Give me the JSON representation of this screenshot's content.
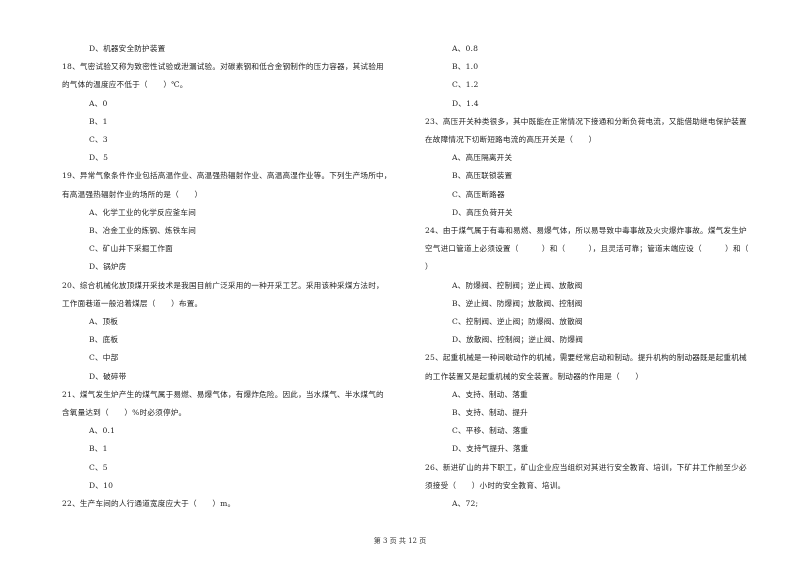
{
  "left_column": [
    {
      "type": "option",
      "text": "D、机器安全防护装置"
    },
    {
      "type": "question",
      "text": "18、气密试验又称为致密性试验或泄漏试验。对碳素钢和低合金钢制作的压力容器，其试验用"
    },
    {
      "type": "question",
      "text": "的气体的温度应不低于（　　）℃。"
    },
    {
      "type": "option",
      "text": "A、0"
    },
    {
      "type": "option",
      "text": "B、1"
    },
    {
      "type": "option",
      "text": "C、3"
    },
    {
      "type": "option",
      "text": "D、5"
    },
    {
      "type": "question",
      "text": "19、异常气象条件作业包括高温作业、高温强热辐射作业、高温高湿作业等。下列生产场所中，"
    },
    {
      "type": "question",
      "text": "有高温强热辐射作业的场所的是（　　）"
    },
    {
      "type": "option",
      "text": "A、化学工业的化学反应釜车间"
    },
    {
      "type": "option",
      "text": "B、冶金工业的炼钢、炼铁车间"
    },
    {
      "type": "option",
      "text": "C、矿山井下采掘工作面"
    },
    {
      "type": "option",
      "text": "D、锅炉房"
    },
    {
      "type": "question",
      "text": "20、综合机械化放顶煤开采技术是我国目前广泛采用的一种开采工艺。采用该种采煤方法时，"
    },
    {
      "type": "question",
      "text": "工作面巷道一般沿着煤层（　　）布置。"
    },
    {
      "type": "option",
      "text": "A、顶板"
    },
    {
      "type": "option",
      "text": "B、底板"
    },
    {
      "type": "option",
      "text": "C、中部"
    },
    {
      "type": "option",
      "text": "D、破碎带"
    },
    {
      "type": "question",
      "text": "21、煤气发生炉产生的煤气属于易燃、易爆气体，有爆炸危险。因此，当水煤气、半水煤气的"
    },
    {
      "type": "question",
      "text": "含氧量达到（　　）%时必须停炉。"
    },
    {
      "type": "option",
      "text": "A、0.1"
    },
    {
      "type": "option",
      "text": "B、1"
    },
    {
      "type": "option",
      "text": "C、5"
    },
    {
      "type": "option",
      "text": "D、10"
    },
    {
      "type": "question",
      "text": "22、生产车间的人行通道宽度应大于（　　）m。"
    }
  ],
  "right_column": [
    {
      "type": "option",
      "text": "A、0.8"
    },
    {
      "type": "option",
      "text": "B、1.0"
    },
    {
      "type": "option",
      "text": "C、1.2"
    },
    {
      "type": "option",
      "text": "D、1.4"
    },
    {
      "type": "question",
      "text": "23、高压开关种类很多，其中既能在正常情况下接通和分断负荷电流，又能借助继电保护装置"
    },
    {
      "type": "question",
      "text": "在故障情况下切断短路电流的高压开关是（　　）"
    },
    {
      "type": "option",
      "text": "A、高压隔离开关"
    },
    {
      "type": "option",
      "text": "B、高压联锁装置"
    },
    {
      "type": "option",
      "text": "C、高压断路器"
    },
    {
      "type": "option",
      "text": "D、高压负荷开关"
    },
    {
      "type": "question",
      "text": "24、由于煤气属于有毒和易燃、易爆气体，所以易导致中毒事故及火灾爆炸事故。煤气发生炉"
    },
    {
      "type": "question",
      "text": "空气进口管道上必须设置（　　　）和（　　　），且灵活可靠；管道末端应设（　　　）和（"
    },
    {
      "type": "question",
      "text": "）"
    },
    {
      "type": "option",
      "text": "A、防爆阀、控制阀；逆止阀、放散阀"
    },
    {
      "type": "option",
      "text": "B、逆止阀、防爆阀；放散阀、控制阀"
    },
    {
      "type": "option",
      "text": "C、控制阀、逆止阀；防爆阀、放散阀"
    },
    {
      "type": "option",
      "text": "D、放散阀、控制阀；逆止阀、防爆阀"
    },
    {
      "type": "question",
      "text": "25、起重机械是一种间歇动作的机械，需要经常启动和制动。提升机构的制动器既是起重机械"
    },
    {
      "type": "question",
      "text": "的工作装置又是起重机械的安全装置。制动器的作用是（　　）"
    },
    {
      "type": "option",
      "text": "A、支持、制动、落重"
    },
    {
      "type": "option",
      "text": "B、支持、制动、提升"
    },
    {
      "type": "option",
      "text": "C、平移、制动、落重"
    },
    {
      "type": "option",
      "text": "D、支持气提升、落重"
    },
    {
      "type": "question",
      "text": "26、新进矿山的井下职工，矿山企业应当组织对其进行安全教育、培训，下矿井工作前至少必"
    },
    {
      "type": "question",
      "text": "须接受（　　）小时的安全教育、培训。"
    },
    {
      "type": "option",
      "text": "A、72;"
    }
  ],
  "footer": {
    "page_label": "第 3 页 共 12 页"
  }
}
